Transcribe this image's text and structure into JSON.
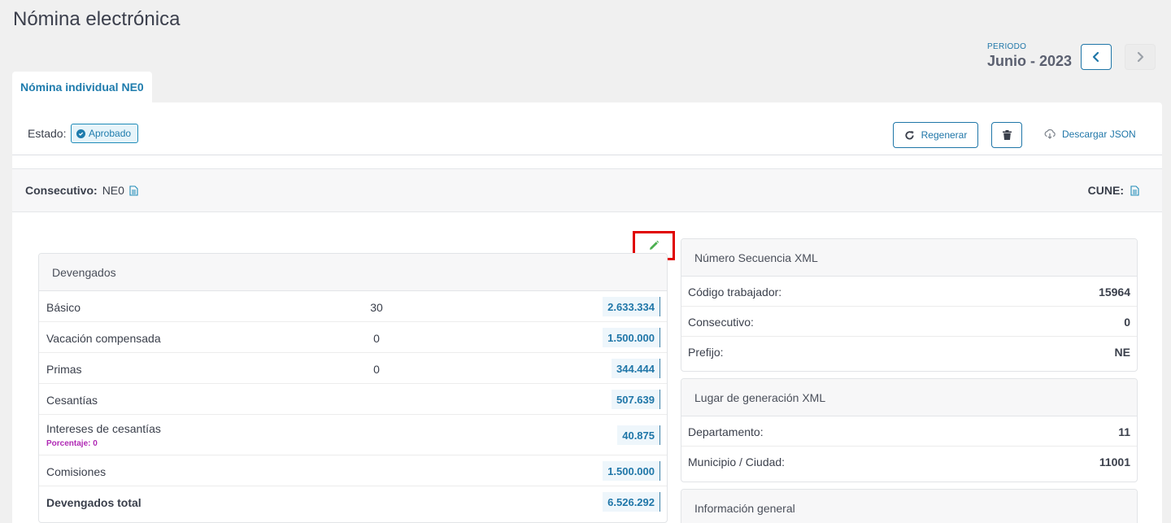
{
  "page": {
    "title": "Nómina electrónica"
  },
  "period": {
    "label": "PERIODO",
    "value": "Junio - 2023"
  },
  "tabs": [
    {
      "label": "Nómina individual NE0"
    }
  ],
  "status": {
    "label": "Estado:",
    "badge": "Aprobado"
  },
  "actions": {
    "regenerate": "Regenerar",
    "download_json": "Descargar JSON"
  },
  "consecutive": {
    "label": "Consecutivo:",
    "value": "NE0",
    "cune_label": "CUNE:"
  },
  "devengados": {
    "title": "Devengados",
    "rows": [
      {
        "name": "Básico",
        "qty": "30",
        "amount": "2.633.334"
      },
      {
        "name": "Vacación compensada",
        "qty": "0",
        "amount": "1.500.000"
      },
      {
        "name": "Primas",
        "qty": "0",
        "amount": "344.444"
      },
      {
        "name": "Cesantías",
        "qty": "",
        "amount": "507.639"
      },
      {
        "name": "Intereses de cesantías",
        "sub": "Porcentaje: 0",
        "qty": "",
        "amount": "40.875"
      },
      {
        "name": "Comisiones",
        "qty": "",
        "amount": "1.500.000"
      }
    ],
    "total": {
      "name": "Devengados total",
      "amount": "6.526.292"
    }
  },
  "secuencia": {
    "title": "Número Secuencia XML",
    "rows": [
      {
        "k": "Código trabajador:",
        "v": "15964"
      },
      {
        "k": "Consecutivo:",
        "v": "0"
      },
      {
        "k": "Prefijo:",
        "v": "NE"
      }
    ]
  },
  "lugar": {
    "title": "Lugar de generación XML",
    "rows": [
      {
        "k": "Departamento:",
        "v": "11"
      },
      {
        "k": "Municipio / Ciudad:",
        "v": "11001"
      }
    ]
  },
  "general": {
    "title": "Información general"
  },
  "colors": {
    "accent": "#1f76a8",
    "highlight": "#e00000",
    "edit": "#4caf50",
    "sub": "#b02ab5"
  },
  "icons": [
    "chevron-left-icon",
    "chevron-right-icon",
    "check-circle-icon",
    "refresh-icon",
    "trash-icon",
    "cloud-download-icon",
    "document-icon",
    "pencil-icon"
  ]
}
